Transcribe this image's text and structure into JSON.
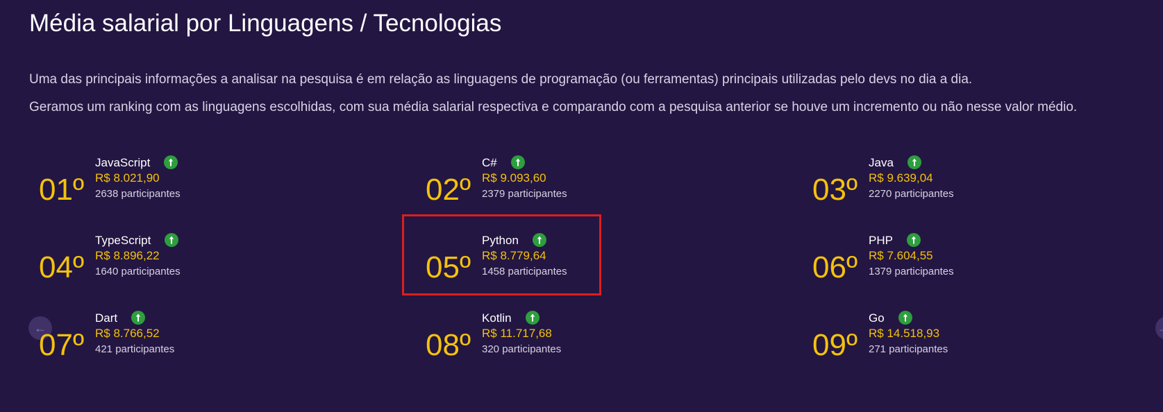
{
  "section": {
    "title": "Média salarial por Linguagens / Tecnologias",
    "description_1": "Uma das principais informações a analisar na pesquisa é em relação as linguagens de programação (ou ferramentas) principais utilizadas pelo devs no dia a dia.",
    "description_2": "Geramos um ranking com as linguagens escolhidas, com sua média salarial respectiva e comparando com a pesquisa anterior se houve um incremento ou não nesse valor médio."
  },
  "colors": {
    "background": "#231642",
    "accent": "#f4c20d",
    "trend_up": "#2e9e3e",
    "highlight": "#dd1e1e"
  },
  "carousel": {
    "prev_icon": "arrow-left-icon",
    "next_icon": "arrow-right-icon"
  },
  "ranking": [
    {
      "rank": "01º",
      "language": "JavaScript",
      "salary": "R$ 8.021,90",
      "participants": "2638 participantes",
      "trend": "up",
      "trend_icon": "arrow-up-icon"
    },
    {
      "rank": "02º",
      "language": "C#",
      "salary": "R$ 9.093,60",
      "participants": "2379 participantes",
      "trend": "up",
      "trend_icon": "arrow-up-icon"
    },
    {
      "rank": "03º",
      "language": "Java",
      "salary": "R$ 9.639,04",
      "participants": "2270 participantes",
      "trend": "up",
      "trend_icon": "arrow-up-icon"
    },
    {
      "rank": "04º",
      "language": "TypeScript",
      "salary": "R$ 8.896,22",
      "participants": "1640 participantes",
      "trend": "up",
      "trend_icon": "arrow-up-icon"
    },
    {
      "rank": "05º",
      "language": "Python",
      "salary": "R$ 8.779,64",
      "participants": "1458 participantes",
      "trend": "up",
      "trend_icon": "arrow-up-icon",
      "highlighted": true
    },
    {
      "rank": "06º",
      "language": "PHP",
      "salary": "R$ 7.604,55",
      "participants": "1379 participantes",
      "trend": "up",
      "trend_icon": "arrow-up-icon"
    },
    {
      "rank": "07º",
      "language": "Dart",
      "salary": "R$ 8.766,52",
      "participants": "421 participantes",
      "trend": "up",
      "trend_icon": "arrow-up-icon"
    },
    {
      "rank": "08º",
      "language": "Kotlin",
      "salary": "R$ 11.717,68",
      "participants": "320 participantes",
      "trend": "up",
      "trend_icon": "arrow-up-icon"
    },
    {
      "rank": "09º",
      "language": "Go",
      "salary": "R$ 14.518,93",
      "participants": "271 participantes",
      "trend": "up",
      "trend_icon": "arrow-up-icon"
    }
  ]
}
